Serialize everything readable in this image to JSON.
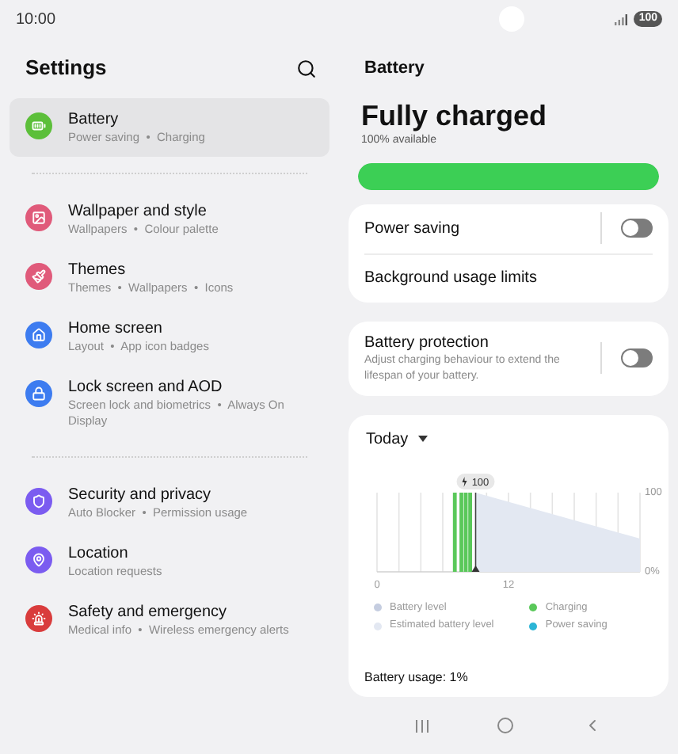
{
  "status_bar": {
    "time": "10:00",
    "battery": "100"
  },
  "sidebar": {
    "title": "Settings",
    "groups": [
      [
        {
          "color": "#5cbf3a",
          "title": "Battery",
          "subtitle": "Power saving  •  Charging",
          "selected": true
        }
      ],
      [
        {
          "color": "#e05a7a",
          "title": "Wallpaper and style",
          "subtitle": "Wallpapers  •  Colour palette",
          "selected": false
        },
        {
          "color": "#e05a7a",
          "title": "Themes",
          "subtitle": "Themes  •  Wallpapers  •  Icons",
          "selected": false
        },
        {
          "color": "#3d7cf0",
          "title": "Home screen",
          "subtitle": "Layout  •  App icon badges",
          "selected": false
        },
        {
          "color": "#3d7cf0",
          "title": "Lock screen and AOD",
          "subtitle": "Screen lock and biometrics  •  Always On Display",
          "selected": false
        }
      ],
      [
        {
          "color": "#7b5cf0",
          "title": "Security and privacy",
          "subtitle": "Auto Blocker  •  Permission usage",
          "selected": false
        },
        {
          "color": "#7b5cf0",
          "title": "Location",
          "subtitle": "Location requests",
          "selected": false
        },
        {
          "color": "#d93c3c",
          "title": "Safety and emergency",
          "subtitle": "Medical info  •  Wireless emergency alerts",
          "selected": false
        }
      ]
    ]
  },
  "battery": {
    "title": "Battery",
    "status": "Fully charged",
    "available": "100% available",
    "level": 1,
    "settings": [
      {
        "title": "Power saving",
        "on": false
      },
      {
        "title": "Background usage limits"
      }
    ],
    "protection": {
      "title": "Battery protection",
      "description": "Adjust charging behaviour to extend the lifespan of your battery.",
      "on": false
    },
    "usage": {
      "period": "Today",
      "chart_data": {
        "type": "area",
        "x": [
          9,
          24
        ],
        "series": [
          {
            "name": "Battery level",
            "color": "#c5cde0",
            "values": [
              null,
              null
            ]
          },
          {
            "name": "Estimated battery level",
            "color": "#e3e8f2",
            "values": [
              100,
              42
            ]
          },
          {
            "name": "Charging",
            "color": "#5ac85a",
            "values": [
              null,
              null
            ]
          },
          {
            "name": "Power saving",
            "color": "#2bb5d6",
            "values": [
              null,
              null
            ]
          }
        ],
        "xlim": [
          0,
          24
        ],
        "ylim": [
          0,
          100
        ],
        "xticks": [
          0,
          12
        ],
        "yticks": [
          {
            "value": 0,
            "label": "0%"
          },
          {
            "value": 100,
            "label": "100"
          }
        ],
        "ref_lines": [
          {
            "axis": "x",
            "value": 7.1,
            "color": "#5ac85a"
          },
          {
            "axis": "x",
            "value": 7.7,
            "color": "#5ac85a"
          },
          {
            "axis": "x",
            "value": 8.1,
            "color": "#5ac85a"
          },
          {
            "axis": "x",
            "value": 8.5,
            "color": "#5ac85a"
          },
          {
            "axis": "x",
            "value": 9,
            "color": "#444444"
          }
        ],
        "annotations": [
          {
            "x": 9,
            "y": 100,
            "text": "100"
          }
        ]
      },
      "summary": "Battery usage: 1%"
    }
  }
}
